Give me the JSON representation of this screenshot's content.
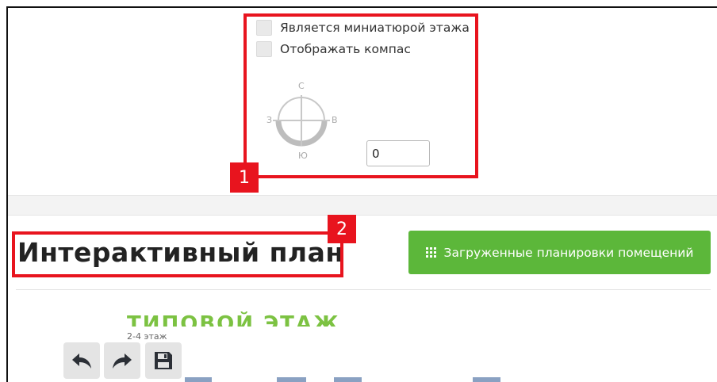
{
  "settings": {
    "thumbnail_checkbox_label": "Является миниатюрой этажа",
    "compass_checkbox_label": "Отображать компас",
    "compass": {
      "north": "С",
      "west": "З",
      "east": "В",
      "south": "Ю"
    },
    "rotation_value": "0"
  },
  "annotations": {
    "badge1": "1",
    "badge2": "2"
  },
  "header": {
    "title": "Интерактивный план",
    "uploaded_plans_button": "Загруженные планировки помещений"
  },
  "floor": {
    "title": "ТИПОВОЙ ЭТАЖ",
    "subtitle": "2-4 этаж"
  },
  "toolbar": {
    "undo_icon": "undo-icon",
    "redo_icon": "redo-icon",
    "save_icon": "save-icon"
  },
  "colors": {
    "accent_green": "#5cb73a",
    "annotation_red": "#e8141e",
    "floor_green": "#7cc242"
  }
}
